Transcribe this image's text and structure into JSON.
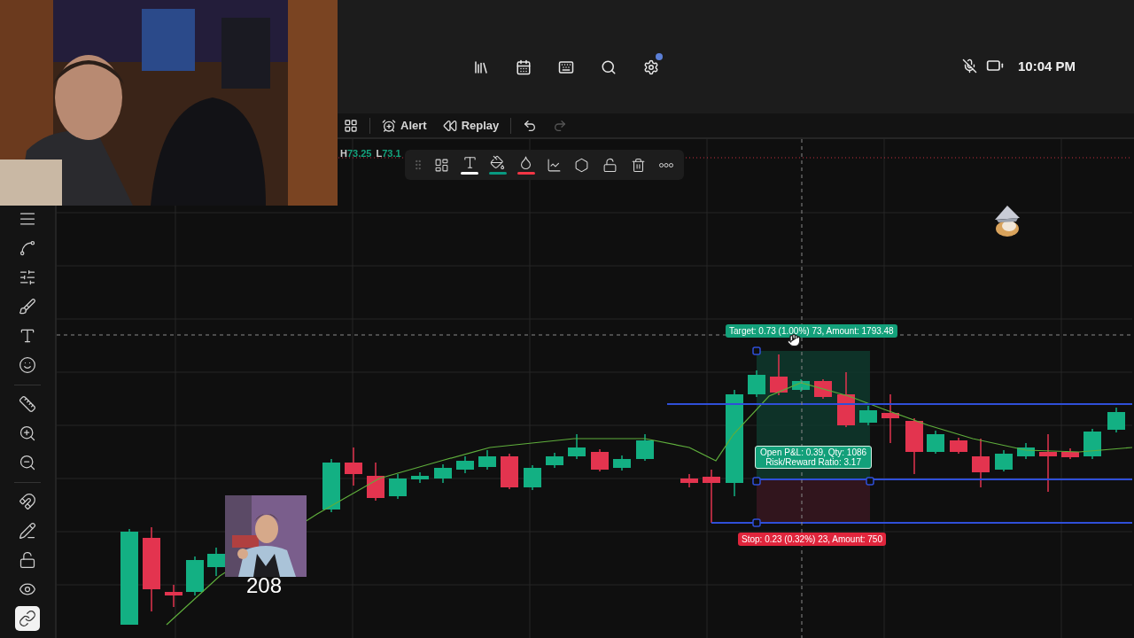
{
  "top_bar": {
    "icons": [
      {
        "kind": "library",
        "badge": false
      },
      {
        "kind": "calendar",
        "badge": false
      },
      {
        "kind": "keyboard",
        "badge": false
      },
      {
        "kind": "search",
        "badge": false
      },
      {
        "kind": "settings",
        "badge": true
      }
    ],
    "status": {
      "mic_muted": true,
      "time": "10:04 PM"
    }
  },
  "toolbar": {
    "items": [
      {
        "kind": "layout",
        "disabled": false
      },
      {
        "kind": "alert",
        "label": "Alert",
        "disabled": false
      },
      {
        "kind": "replay",
        "label": "Replay",
        "disabled": false
      },
      {
        "kind": "undo",
        "disabled": false
      },
      {
        "kind": "redo",
        "disabled": true
      }
    ]
  },
  "sidebar": {
    "tools": [
      {
        "kind": "lines",
        "selected": false
      },
      {
        "kind": "pattern",
        "selected": false
      },
      {
        "kind": "fib",
        "selected": false
      },
      {
        "kind": "brush",
        "selected": false
      },
      {
        "kind": "text",
        "selected": false
      },
      {
        "kind": "emoji",
        "selected": false
      },
      {
        "kind": "ruler",
        "selected": false
      },
      {
        "kind": "zoom_in",
        "selected": false
      },
      {
        "kind": "zoom_out",
        "selected": false
      },
      {
        "kind": "magnet",
        "selected": false
      },
      {
        "kind": "lock_drawing",
        "selected": false
      },
      {
        "kind": "lock",
        "selected": false
      },
      {
        "kind": "eye",
        "selected": false
      },
      {
        "kind": "link",
        "selected": true
      }
    ]
  },
  "chart": {
    "ohlc": [
      {
        "label": "H",
        "value": "73.25"
      },
      {
        "label": "L",
        "value": "73.1"
      }
    ],
    "drawing_toolbar": [
      {
        "kind": "templates"
      },
      {
        "kind": "text",
        "color": "#ffffff"
      },
      {
        "kind": "fill",
        "color": "#089981"
      },
      {
        "kind": "border",
        "color": "#f23645"
      },
      {
        "kind": "add_chart"
      },
      {
        "kind": "settings"
      },
      {
        "kind": "unlock"
      },
      {
        "kind": "delete"
      },
      {
        "kind": "more"
      }
    ],
    "position": {
      "target_label": "Target: 0.73 (1.00%) 73, Amount: 1793.48",
      "pnl_lines": [
        "Open P&L: 0.39, Qty: 1086",
        "Risk/Reward Ratio: 3.17"
      ],
      "stop_label": "Stop: 0.23 (0.32%) 23, Amount: 750"
    },
    "meme": {
      "kind": "picture",
      "caption": "208"
    }
  }
}
